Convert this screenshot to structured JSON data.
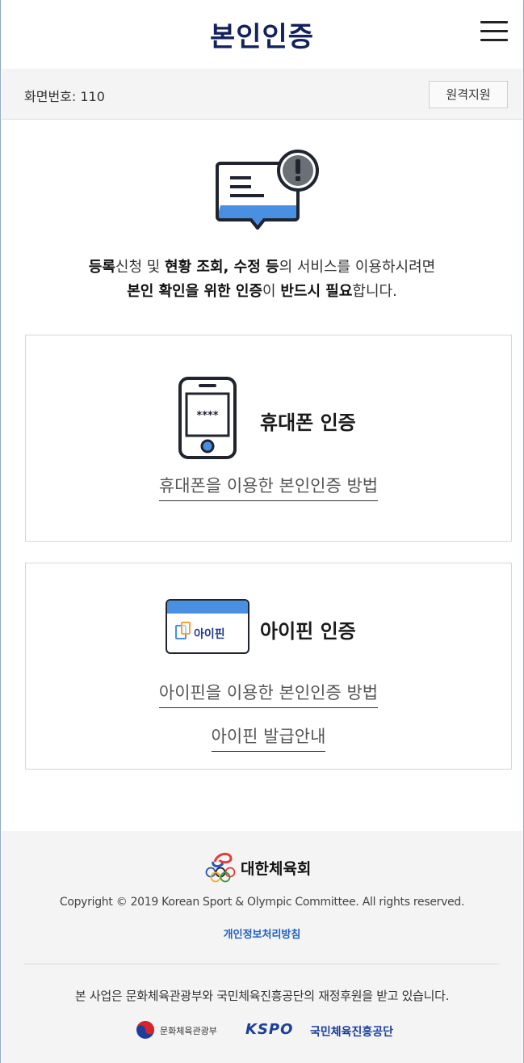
{
  "header": {
    "title": "본인인증",
    "menu_icon": "hamburger-menu-icon"
  },
  "infobar": {
    "screen_number": "화면번호: 110",
    "remote_support_label": "원격지원"
  },
  "notice": {
    "icon": "message-alert-icon",
    "line1": {
      "p1": "등록",
      "p2": "신청 및 ",
      "p3": "현황 조회, 수정 등",
      "p4": "의 서비스를 이용하시려면"
    },
    "line2": {
      "p1": "본인 확인을 위한 인증",
      "p2": "이 ",
      "p3": "반드시 필요",
      "p4": "합니다."
    }
  },
  "phone_auth": {
    "icon": "mobile-phone-icon",
    "icon_text": "****",
    "title": "휴대폰 인증",
    "guide_link": "휴대폰을 이용한 본인인증 방법"
  },
  "ipin_auth": {
    "icon": "ipin-badge-icon",
    "badge_text": "아이핀",
    "title": "아이핀 인증",
    "guide_link": "아이핀을 이용한 본인인증 방법",
    "issue_link": "아이핀 발급안내"
  },
  "footer": {
    "logo_text": "대한체육회",
    "copyright": "Copyright © 2019 Korean Sport & Olympic Committee. All rights reserved.",
    "privacy_link": "개인정보처리방침",
    "sponsor_text": "본 사업은 문화체육관광부와 국민체육진흥공단의 재정후원을 받고 있습니다.",
    "mcst_name": "문화체육관광부",
    "kspo_mark": "KSPO",
    "kspo_name": "국민체육진흥공단"
  },
  "colors": {
    "title_navy": "#13215e",
    "accent_blue": "#4a90e2",
    "link_blue": "#1d5fc6"
  }
}
